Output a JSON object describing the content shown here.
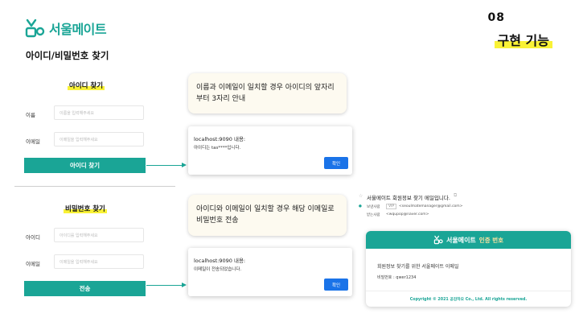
{
  "header": {
    "logo_text": "서울메이트",
    "page_title": "아이디/비밀번호 찾기",
    "section_number": "08",
    "section_title": "구현 기능"
  },
  "find_id": {
    "heading": "아이디 찾기",
    "name_label": "이름",
    "name_placeholder": "이름을 입력해주세요",
    "email_label": "이메일",
    "email_placeholder": "이메일을 입력해주세요",
    "button_label": "아이디 찾기",
    "callout": "이름과 이메일이 일치할 경우 아이디의 앞자리부터 3자리 안내",
    "dialog": {
      "title": "localhost:9090 내용:",
      "message": "아이디는 tas****입니다.",
      "ok": "확인"
    }
  },
  "find_pw": {
    "heading": "비밀번호 찾기",
    "id_label": "아이디",
    "id_placeholder": "아이디를 입력해주세요",
    "email_label": "이메일",
    "email_placeholder": "이메일을 입력해주세요",
    "button_label": "전송",
    "callout": "아이디와 이메일이 일치할 경우 해당 이메일로 비밀번호 전송",
    "dialog": {
      "title": "localhost:9090 내용:",
      "message": "이메일이 전송되었습니다.",
      "ok": "확인"
    }
  },
  "email": {
    "subject": "서울메이트 회원정보 찾기 메일입니다.",
    "from_label": "보낸사람",
    "from_tag": "VIP",
    "from_address": "<seoulmatemanager@gmail.com>",
    "to_label": "받는사람",
    "to_address": "<wqupop@naver.com>",
    "card_brand": "서울메이트",
    "card_subtitle": "인증 번호",
    "body_text": "회원정보 찾기를 위한 서울메이트 이메일",
    "password_line": "비밀번호 : qwer1234",
    "footer": "Copyright © 2021 공감하오 Co., Ltd. All rights reserved."
  },
  "colors": {
    "brand_teal": "#1aa596",
    "highlight_yellow": "#f9f236",
    "ok_blue": "#1a73e8"
  }
}
